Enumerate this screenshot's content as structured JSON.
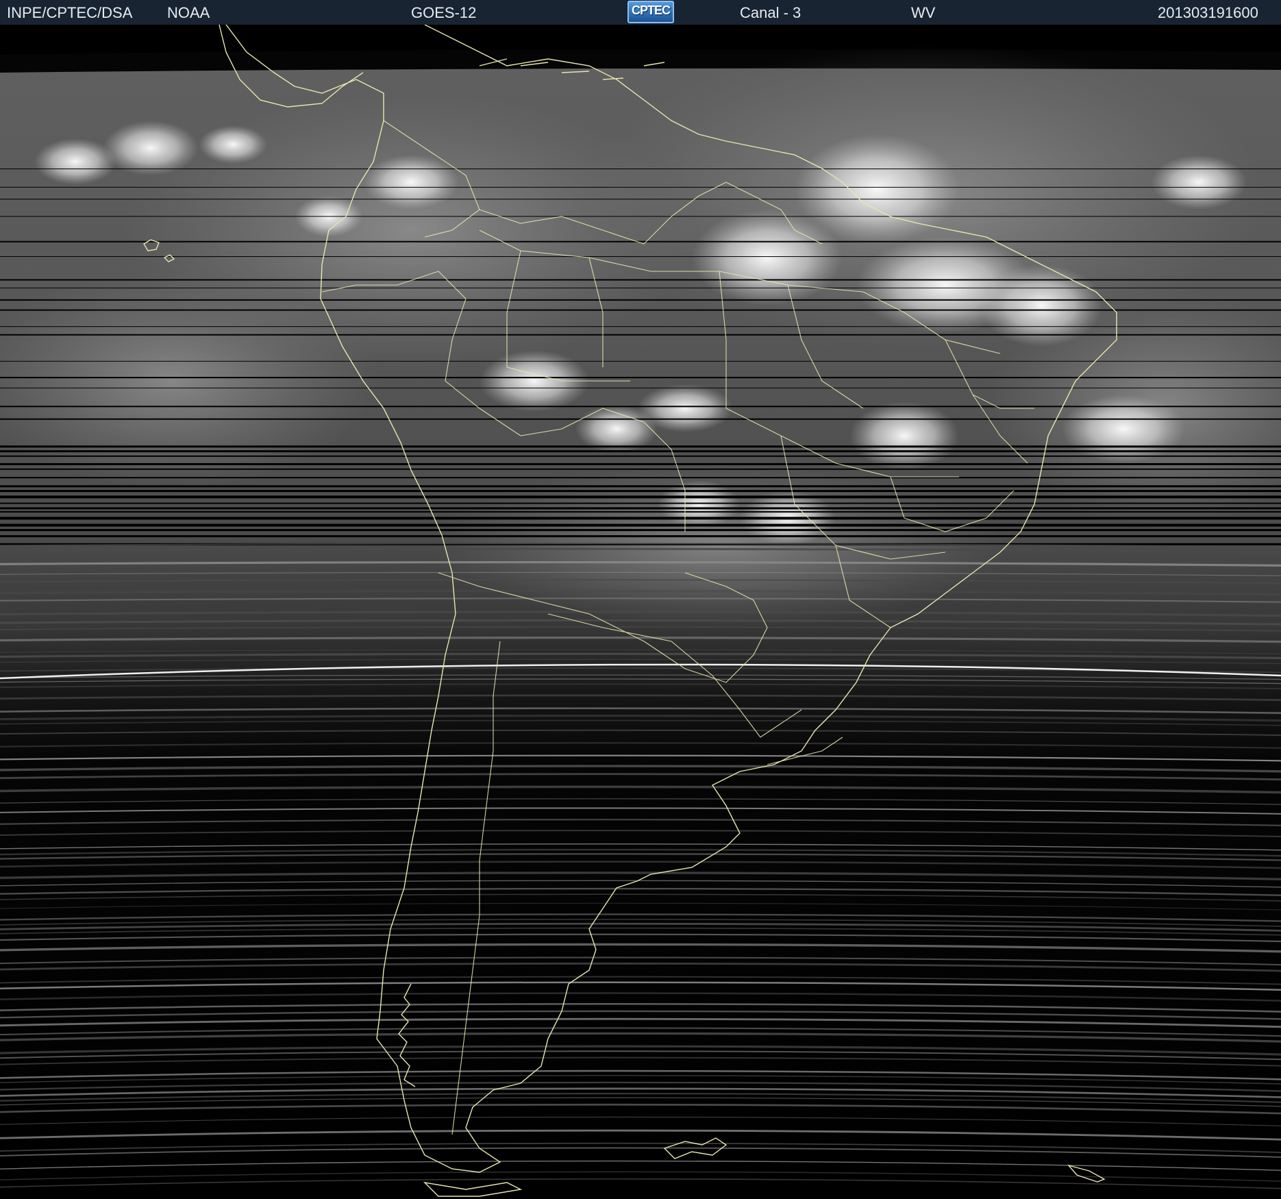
{
  "header": {
    "agency": "INPE/CPTEC/DSA",
    "provider": "NOAA",
    "satellite": "GOES-12",
    "logo_text": "CPTEC",
    "channel": "Canal - 3",
    "band": "WV",
    "datetime": "201303191600"
  },
  "colors": {
    "header_bg": "#182432",
    "header_text": "#e6ecf2",
    "coastline": "#e8e6b0",
    "background": "#000000"
  },
  "map": {
    "region": "South America",
    "projection": "satellite scan",
    "imagery": "water vapor grayscale"
  }
}
